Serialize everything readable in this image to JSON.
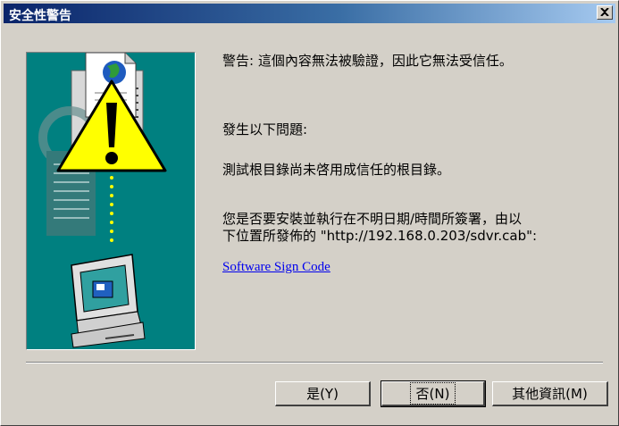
{
  "window": {
    "title": "安全性警告"
  },
  "body": {
    "warning": "警告: 這個內容無法被驗證，因此它無法受信任。",
    "problem_label": "發生以下問題:",
    "problem_text": "測試根目錄尚未啓用成信任的根目錄。",
    "install_question_line1": "您是否要安裝並執行在不明日期/時間所簽署，由以",
    "install_question_line2": "下位置所發佈的 \"http://192.168.0.203/sdvr.cab\":",
    "publisher_link": "Software Sign Code"
  },
  "buttons": {
    "yes": "是(Y)",
    "no": "否(N)",
    "more_info": "其他資訊(M)"
  },
  "colors": {
    "title_start": "#0a246a",
    "title_end": "#a6caf0",
    "art_background": "#008080",
    "link": "#0000ee",
    "dialog_background": "#d4d0c8"
  }
}
